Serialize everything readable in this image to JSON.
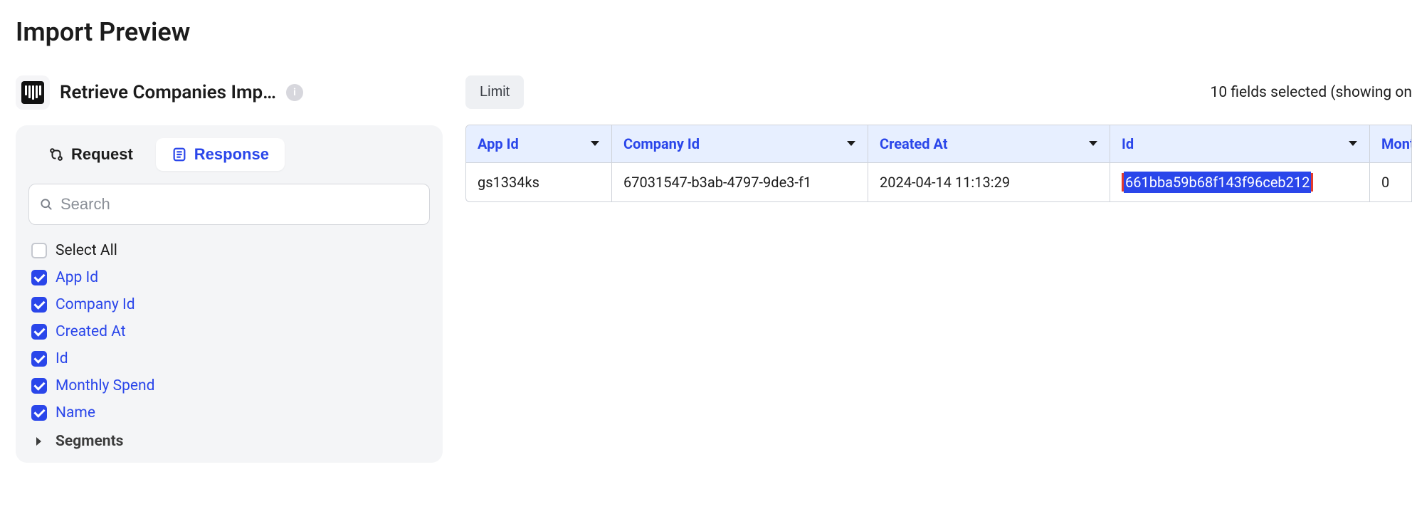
{
  "pageTitle": "Import Preview",
  "source": {
    "name": "Retrieve Companies Imp…"
  },
  "sidebar": {
    "tabs": {
      "request": "Request",
      "response": "Response",
      "active": "response"
    },
    "searchPlaceholder": "Search",
    "selectAllLabel": "Select All",
    "fields": [
      {
        "label": "App Id",
        "checked": true
      },
      {
        "label": "Company Id",
        "checked": true
      },
      {
        "label": "Created At",
        "checked": true
      },
      {
        "label": "Id",
        "checked": true
      },
      {
        "label": "Monthly Spend",
        "checked": true
      },
      {
        "label": "Name",
        "checked": true
      }
    ],
    "segmentsLabel": "Segments"
  },
  "main": {
    "limitLabel": "Limit",
    "fieldsSelectedText": "10 fields selected (showing on",
    "columns": {
      "appId": "App Id",
      "companyId": "Company Id",
      "createdAt": "Created At",
      "id": "Id",
      "month": "Month"
    },
    "rows": [
      {
        "appId": "gs1334ks",
        "companyId": "67031547-b3ab-4797-9de3-f1",
        "createdAt": "2024-04-14 11:13:29",
        "id": "661bba59b68f143f96ceb212",
        "month": "0"
      }
    ]
  }
}
